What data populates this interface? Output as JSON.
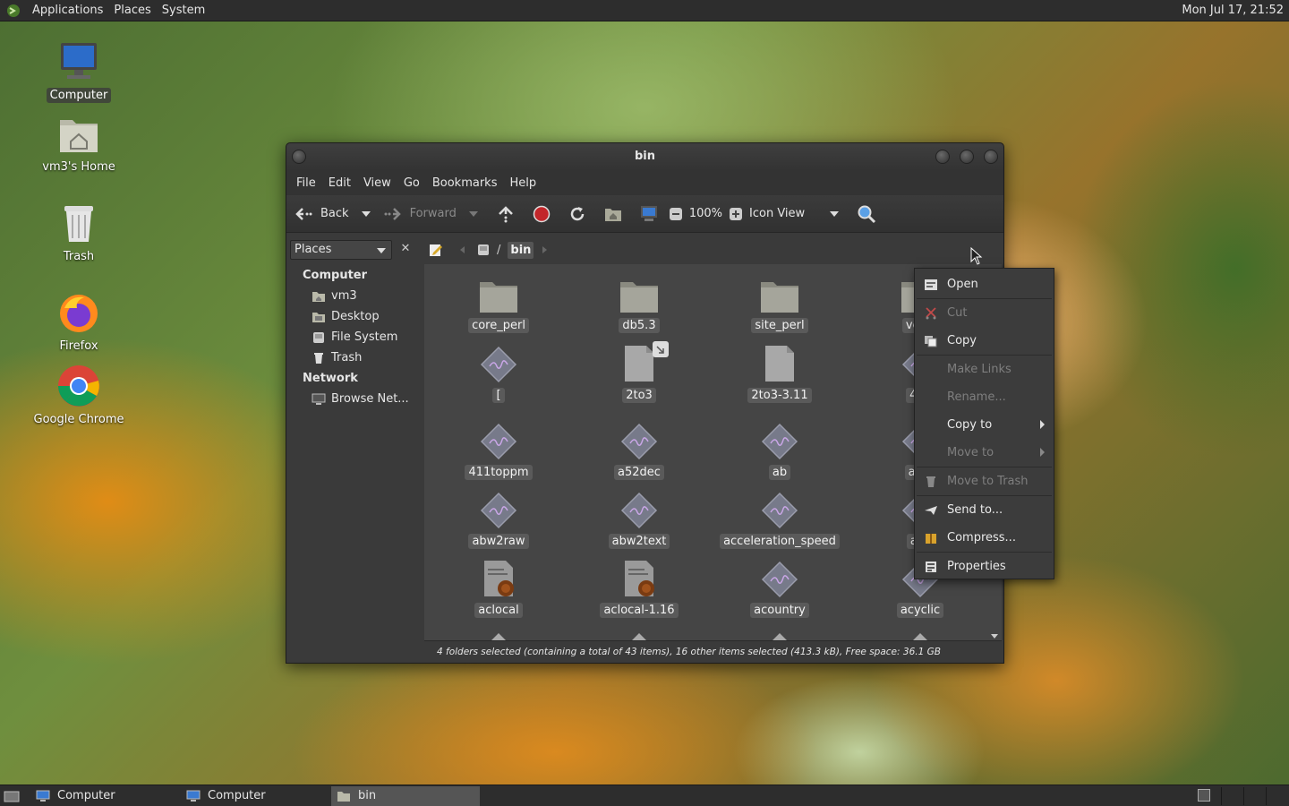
{
  "top_panel": {
    "menus": [
      "Applications",
      "Places",
      "System"
    ],
    "clock": "Mon Jul 17, 21:52"
  },
  "desktop_icons": [
    {
      "label": "Computer",
      "icon": "monitor-icon"
    },
    {
      "label": "vm3's Home",
      "icon": "home-folder-icon"
    },
    {
      "label": "Trash",
      "icon": "trash-icon"
    },
    {
      "label": "Firefox",
      "icon": "firefox-icon"
    },
    {
      "label": "Google Chrome",
      "icon": "chrome-icon"
    }
  ],
  "window": {
    "title": "bin",
    "menus": [
      "File",
      "Edit",
      "View",
      "Go",
      "Bookmarks",
      "Help"
    ],
    "toolbar": {
      "back": "Back",
      "forward": "Forward",
      "zoom": "100%",
      "view_mode": "Icon View"
    },
    "places_label": "Places",
    "path": {
      "root_sep": "/",
      "current": "bin"
    },
    "sidebar": {
      "computer_header": "Computer",
      "computer_items": [
        "vm3",
        "Desktop",
        "File System",
        "Trash"
      ],
      "network_header": "Network",
      "network_items": [
        "Browse Net..."
      ]
    },
    "files": [
      {
        "name": "core_perl",
        "type": "folder"
      },
      {
        "name": "db5.3",
        "type": "folder"
      },
      {
        "name": "site_perl",
        "type": "folder"
      },
      {
        "name": "vend",
        "type": "folder"
      },
      {
        "name": "[",
        "type": "exec"
      },
      {
        "name": "2to3",
        "type": "doc"
      },
      {
        "name": "2to3-3.11",
        "type": "doc"
      },
      {
        "name": "4ch",
        "type": "exec"
      },
      {
        "name": "411toppm",
        "type": "exec"
      },
      {
        "name": "a52dec",
        "type": "exec"
      },
      {
        "name": "ab",
        "type": "exec"
      },
      {
        "name": "abw",
        "type": "exec"
      },
      {
        "name": "abw2raw",
        "type": "exec"
      },
      {
        "name": "abw2text",
        "type": "exec"
      },
      {
        "name": "acceleration_speed",
        "type": "exec"
      },
      {
        "name": "acc",
        "type": "exec"
      },
      {
        "name": "aclocal",
        "type": "script"
      },
      {
        "name": "aclocal-1.16",
        "type": "script"
      },
      {
        "name": "acountry",
        "type": "exec"
      },
      {
        "name": "acyclic",
        "type": "exec"
      }
    ],
    "status": "4 folders selected (containing a total of 43 items), 16 other items selected (413.3 kB), Free space: 36.1 GB"
  },
  "context_menu": {
    "items": [
      {
        "label": "Open",
        "enabled": true
      },
      {
        "label": "Cut",
        "enabled": false
      },
      {
        "label": "Copy",
        "enabled": true
      },
      {
        "label": "Make Links",
        "enabled": false
      },
      {
        "label": "Rename...",
        "enabled": false
      },
      {
        "label": "Copy to",
        "enabled": true
      },
      {
        "label": "Move to",
        "enabled": false
      },
      {
        "label": "Move to Trash",
        "enabled": false
      },
      {
        "label": "Send to...",
        "enabled": true
      },
      {
        "label": "Compress...",
        "enabled": true
      },
      {
        "label": "Properties",
        "enabled": true
      }
    ]
  },
  "taskbar": {
    "tasks": [
      "Computer",
      "Computer",
      "bin"
    ]
  }
}
